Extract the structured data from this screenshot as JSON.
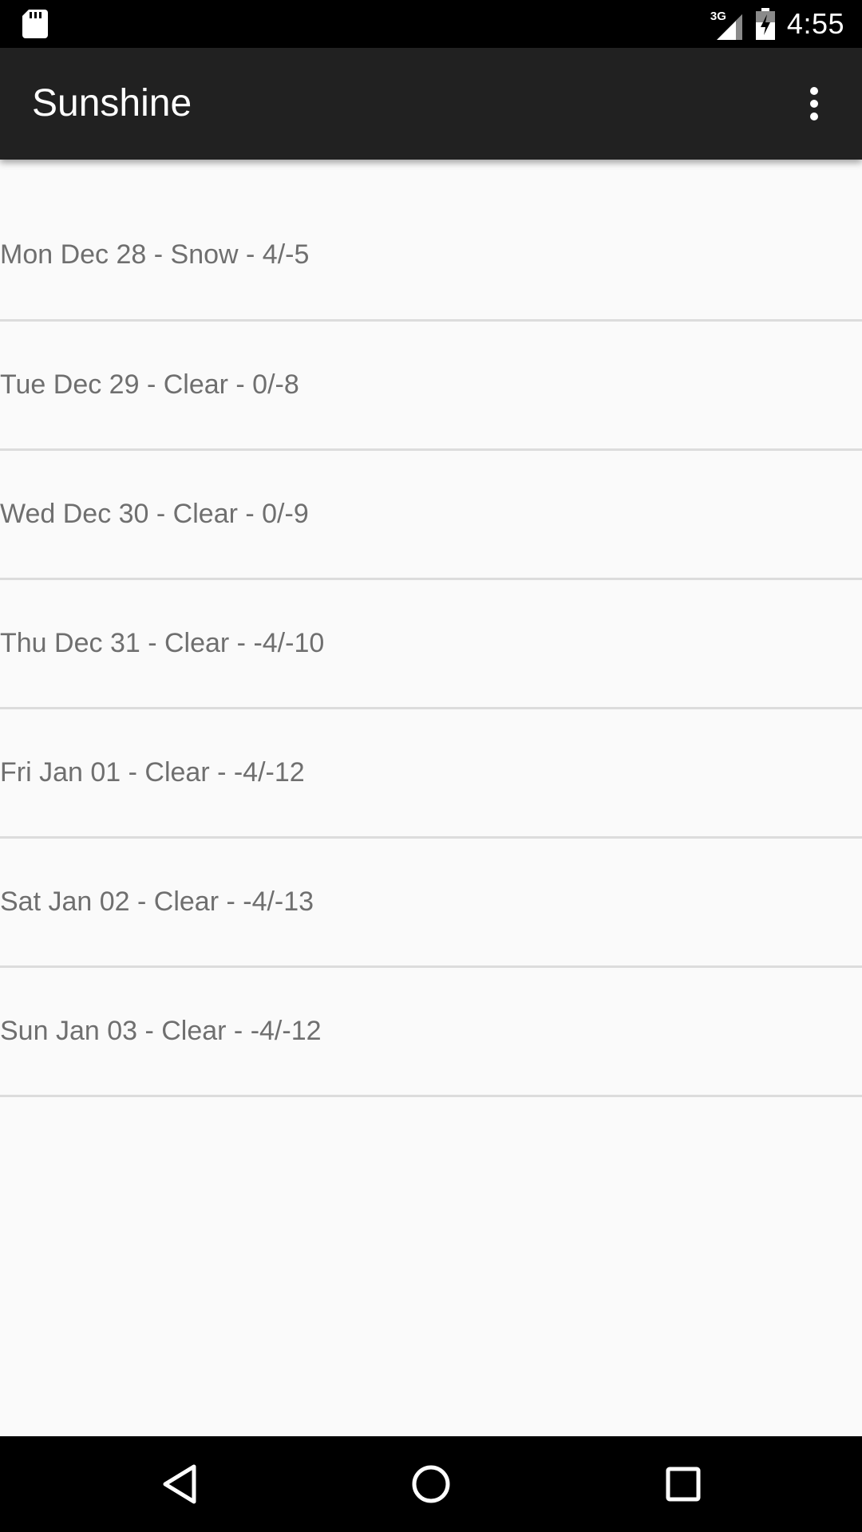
{
  "status_bar": {
    "network_type": "3G",
    "time": "4:55",
    "icons": [
      "sd-card-icon",
      "signal-icon",
      "battery-icon"
    ]
  },
  "app_bar": {
    "title": "Sunshine",
    "overflow_icon": "more-vert-icon"
  },
  "forecast": {
    "items": [
      {
        "label": "Mon Dec 28 - Snow - 4/-5"
      },
      {
        "label": "Tue Dec 29 - Clear - 0/-8"
      },
      {
        "label": "Wed Dec 30 - Clear - 0/-9"
      },
      {
        "label": "Thu Dec 31 - Clear - -4/-10"
      },
      {
        "label": "Fri Jan 01 - Clear - -4/-12"
      },
      {
        "label": "Sat Jan 02 - Clear - -4/-13"
      },
      {
        "label": "Sun Jan 03 - Clear - -4/-12"
      }
    ]
  },
  "nav_bar": {
    "icons": [
      "back-icon",
      "home-icon",
      "recents-icon"
    ]
  },
  "colors": {
    "status_bar": "#000000",
    "app_bar": "#212121",
    "background": "#fafafa",
    "list_text": "#6f6f6f",
    "divider": "#dcdcdc"
  }
}
